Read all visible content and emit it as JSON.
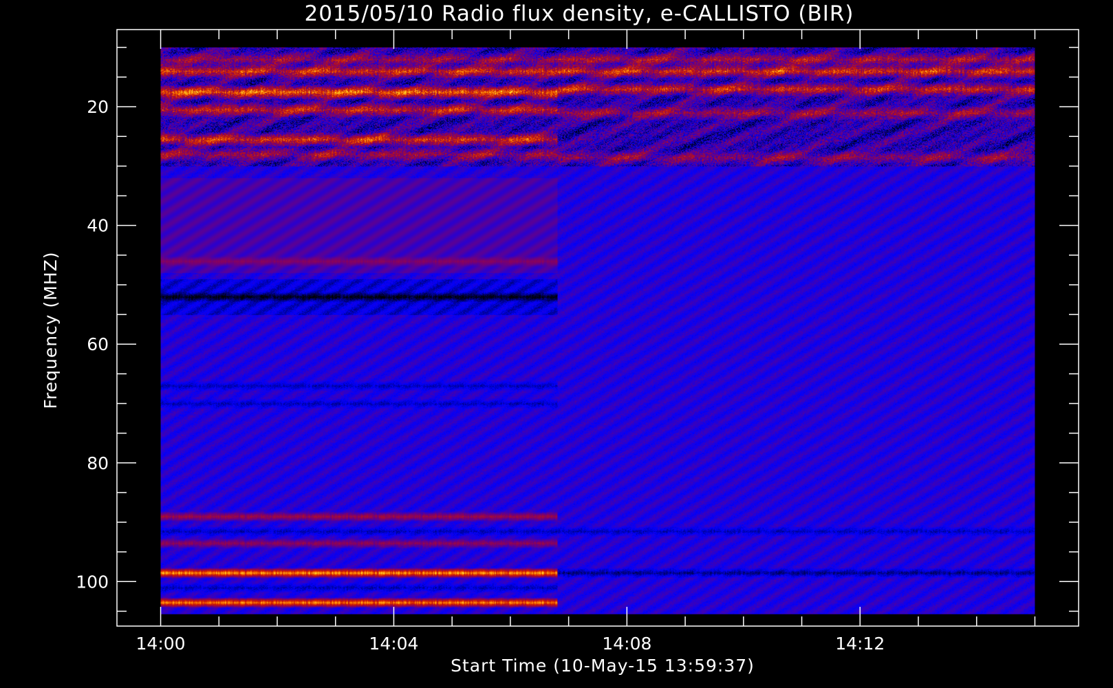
{
  "chart_data": {
    "type": "heatmap",
    "title": "2015/05/10  Radio flux density, e-CALLISTO (BIR)",
    "xlabel": "Start Time (10-May-15 13:59:37)",
    "ylabel": "Frequency (MHZ)",
    "x_ticks": [
      "14:00",
      "14:04",
      "14:08",
      "14:12"
    ],
    "x_tick_minutes": [
      0,
      4,
      8,
      12
    ],
    "x_minor_step_minutes": 1,
    "y_ticks": [
      20,
      40,
      60,
      80,
      100
    ],
    "y_minor_step": 5,
    "xlim_minutes": [
      -0.75,
      15.75
    ],
    "ylim": [
      107.5,
      7
    ],
    "data_extent": {
      "t_start_min": 0,
      "t_end_min": 15,
      "f_min": 10,
      "f_max": 105.5
    },
    "instrument_switch_minute": 6.8,
    "colormap": [
      "#000000",
      "#0000ff",
      "#7a0070",
      "#cc1500",
      "#ff7f00",
      "#ffff40"
    ],
    "bands_before_switch": [
      {
        "f": 12,
        "level": 0.55
      },
      {
        "f": 14,
        "level": 0.75
      },
      {
        "f": 17.5,
        "level": 0.9
      },
      {
        "f": 20.5,
        "level": 0.7
      },
      {
        "f": 25.5,
        "level": 0.75
      },
      {
        "f": 28,
        "level": 0.55
      },
      {
        "f": 46,
        "level": 0.4
      },
      {
        "f": 52,
        "level": 0.05
      },
      {
        "f": 67,
        "level": 0.1
      },
      {
        "f": 70,
        "level": 0.1
      },
      {
        "f": 89,
        "level": 0.55
      },
      {
        "f": 91.5,
        "level": 0.1
      },
      {
        "f": 93.5,
        "level": 0.5
      },
      {
        "f": 98.5,
        "level": 1.0
      },
      {
        "f": 101,
        "level": 0.1
      },
      {
        "f": 103.5,
        "level": 0.95
      }
    ],
    "bands_after_switch": [
      {
        "f": 12,
        "level": 0.6
      },
      {
        "f": 14,
        "level": 0.75
      },
      {
        "f": 17,
        "level": 0.7
      },
      {
        "f": 21,
        "level": 0.55
      },
      {
        "f": 28.5,
        "level": 0.5
      },
      {
        "f": 91.5,
        "level": 0.1
      },
      {
        "f": 98.5,
        "level": 0.05
      }
    ]
  }
}
